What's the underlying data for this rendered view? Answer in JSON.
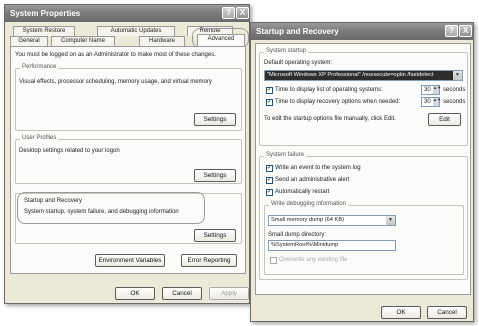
{
  "sys_props": {
    "title": "System Properties",
    "help_btn": "?",
    "close_btn": "X",
    "tabs_row1": [
      "System Restore",
      "Automatic Updates",
      "Remote"
    ],
    "tabs_row2": [
      "General",
      "Computer Name",
      "Hardware",
      "Advanced"
    ],
    "admin_note": "You must be logged on as an Administrator to make most of these changes.",
    "performance": {
      "title": "Performance",
      "desc": "Visual effects, processor scheduling, memory usage, and virtual memory",
      "settings": "Settings"
    },
    "user_profiles": {
      "title": "User Profiles",
      "desc": "Desktop settings related to your logon",
      "settings": "Settings"
    },
    "startup_recovery": {
      "title": "Startup and Recovery",
      "desc": "System startup, system failure, and debugging information",
      "settings": "Settings"
    },
    "env_vars": "Environment Variables",
    "error_reporting": "Error Reporting",
    "ok": "OK",
    "cancel": "Cancel",
    "apply": "Apply"
  },
  "startup": {
    "title": "Startup and Recovery",
    "help_btn": "?",
    "close_btn": "X",
    "system_startup_title": "System startup",
    "default_os_label": "Default operating system:",
    "default_os_value": "\"Microsoft Windows XP Professional\" /noexecute=optin /fastdetect",
    "time_list_label": "Time to display list of operating systems:",
    "time_list_value": "30",
    "time_recovery_label": "Time to display recovery options when needed:",
    "time_recovery_value": "30",
    "seconds": "seconds",
    "edit_note": "To edit the startup options file manually, click Edit.",
    "edit_btn": "Edit",
    "system_failure_title": "System failure",
    "write_event": "Write an event to the system log",
    "send_alert": "Send an administrative alert",
    "auto_restart": "Automatically restart",
    "write_debug_title": "Write debugging information",
    "debug_value": "Small memory dump (64 KB)",
    "small_dump_label": "Small dump directory:",
    "small_dump_value": "%SystemRoot%\\Minidump",
    "overwrite": "Overwrite any existing file",
    "ok": "OK",
    "cancel": "Cancel"
  }
}
